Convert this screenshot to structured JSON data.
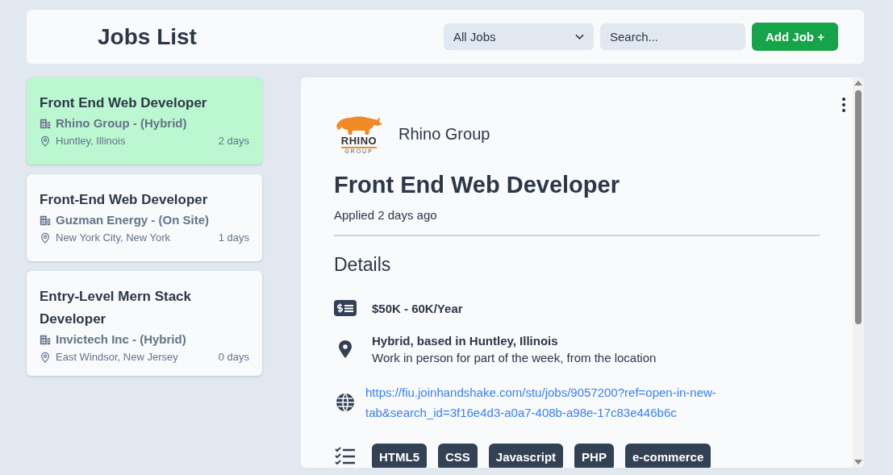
{
  "header": {
    "title": "Jobs List",
    "filter": {
      "value": "All Jobs"
    },
    "search": {
      "placeholder": "Search..."
    },
    "add_button": "Add Job +"
  },
  "jobs": [
    {
      "title": "Front End Web Developer",
      "company": "Rhino Group - (Hybrid)",
      "location": "Huntley, Illinois",
      "age": "2 days",
      "selected": true
    },
    {
      "title": "Front-End Web Developer",
      "company": "Guzman Energy - (On Site)",
      "location": "New York City, New York",
      "age": "1 days",
      "selected": false
    },
    {
      "title": "Entry-Level Mern Stack Developer",
      "company": "Invictech Inc - (Hybrid)",
      "location": "East Windsor, New Jersey",
      "age": "0 days",
      "selected": false
    }
  ],
  "detail": {
    "logo": {
      "wordmark": "RHINO",
      "subtitle": "GROUP"
    },
    "company": "Rhino Group",
    "title": "Front End Web Developer",
    "applied": "Applied 2 days ago",
    "section": "Details",
    "items": [
      {
        "kind": "salary",
        "text": "$50K - 60K/Year"
      },
      {
        "kind": "location",
        "heading": "Hybrid, based in Huntley, Illinois",
        "text": "Work in person for part of the week, from the location"
      },
      {
        "kind": "link",
        "text": "https://fiu.joinhandshake.com/stu/jobs/9057200?ref=open-in-new-tab&search_id=3f16e4d3-a0a7-408b-a98e-17c83e446b6c"
      },
      {
        "kind": "skills",
        "tags": [
          "HTML5",
          "CSS",
          "Javascript",
          "PHP",
          "e-commerce"
        ]
      }
    ]
  }
}
